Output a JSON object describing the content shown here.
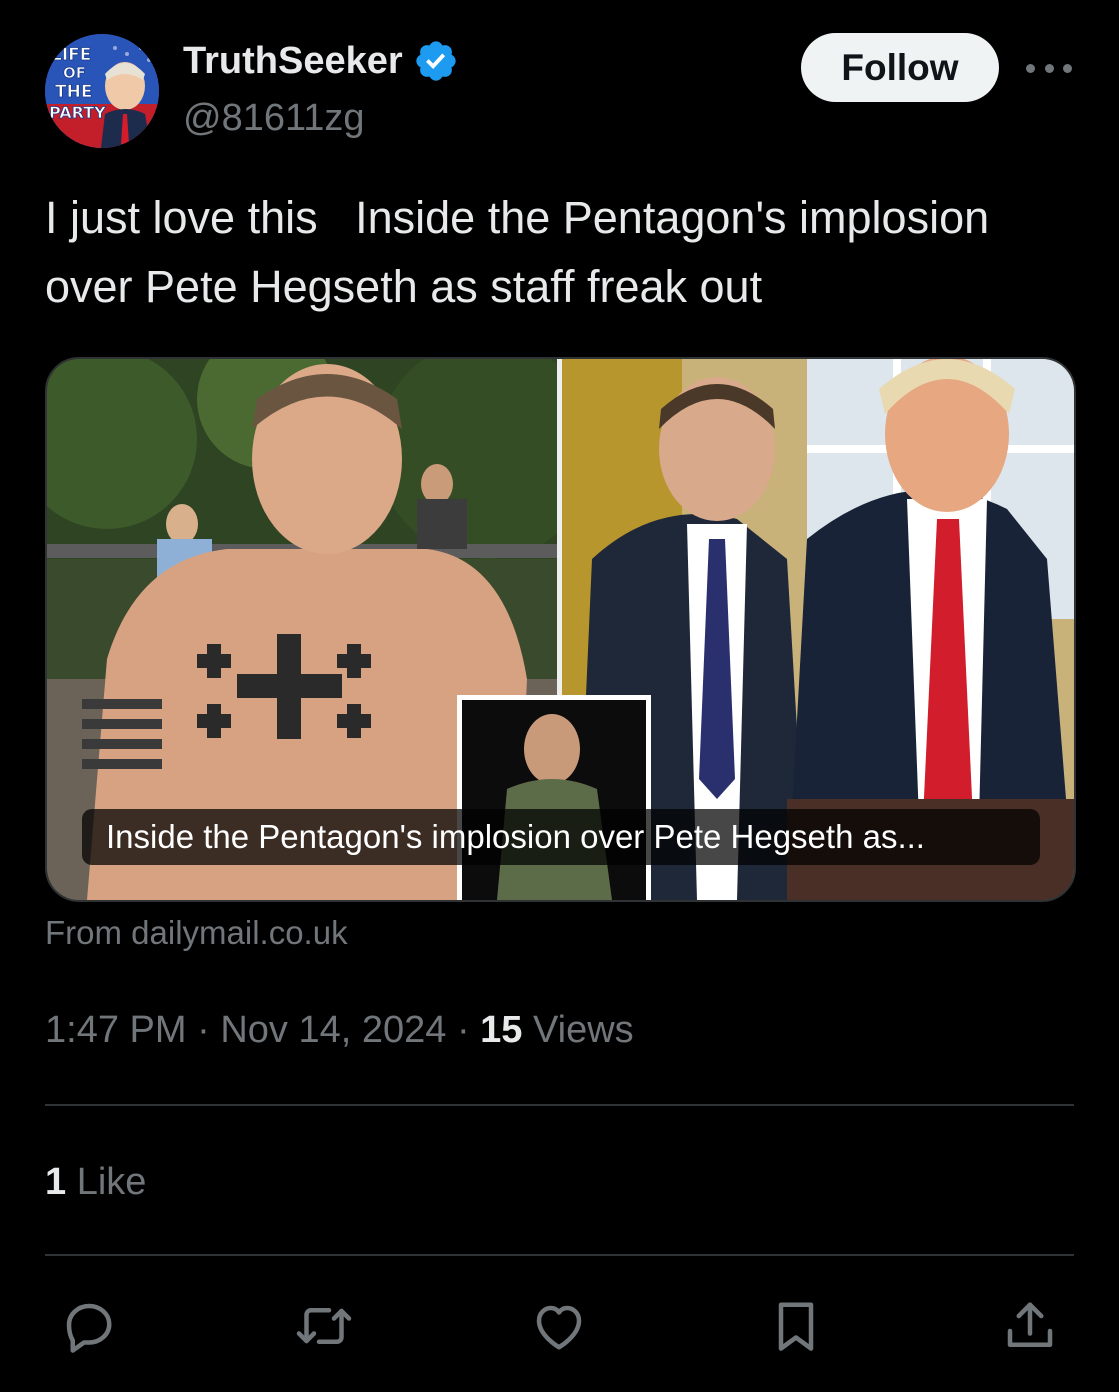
{
  "author": {
    "display_name": "TruthSeeker",
    "handle": "@81611zg",
    "verified": true,
    "avatar_text": [
      "LIFE",
      "OF",
      "THE",
      "PARTY"
    ]
  },
  "follow_button": {
    "label": "Follow"
  },
  "more_button": {
    "icon": "more-horizontal-icon"
  },
  "tweet": {
    "text": "I just love this   Inside the Pentagon's implosion over Pete Hegseth as staff freak out"
  },
  "link_card": {
    "title": "Inside the Pentagon's implosion over Pete Hegseth as...",
    "source": "From dailymail.co.uk"
  },
  "meta": {
    "time": "1:47 PM",
    "separator": "·",
    "date": "Nov 14, 2024",
    "views_count": "15",
    "views_label": "Views"
  },
  "engagement": {
    "likes_count": "1",
    "likes_label": "Like"
  },
  "actions": [
    {
      "icon": "reply-icon"
    },
    {
      "icon": "retweet-icon"
    },
    {
      "icon": "like-icon"
    },
    {
      "icon": "bookmark-icon"
    },
    {
      "icon": "share-icon"
    }
  ],
  "colors": {
    "background": "#000000",
    "text_primary": "#e7e9ea",
    "text_secondary": "#71767b",
    "verified_badge": "#1d9bf0",
    "follow_bg": "#eff3f4",
    "divider": "#2f3336"
  }
}
